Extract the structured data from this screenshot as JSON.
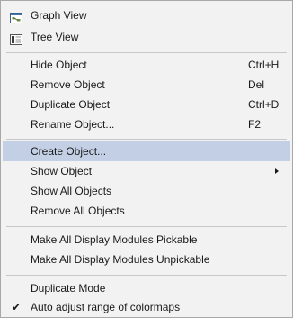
{
  "menu": {
    "items": [
      {
        "label": "Graph View",
        "icon": "graph-view-icon"
      },
      {
        "label": "Tree View",
        "icon": "tree-view-icon"
      },
      {
        "label": "Hide Object",
        "shortcut": "Ctrl+H"
      },
      {
        "label": "Remove Object",
        "shortcut": "Del"
      },
      {
        "label": "Duplicate Object",
        "shortcut": "Ctrl+D"
      },
      {
        "label": "Rename Object...",
        "shortcut": "F2"
      },
      {
        "label": "Create Object...",
        "highlighted": true
      },
      {
        "label": "Show Object",
        "submenu": true
      },
      {
        "label": "Show All Objects"
      },
      {
        "label": "Remove All Objects"
      },
      {
        "label": "Make All Display Modules Pickable"
      },
      {
        "label": "Make All Display Modules Unpickable"
      },
      {
        "label": "Duplicate Mode"
      },
      {
        "label": "Auto adjust range of colormaps",
        "checked": true
      }
    ],
    "highlight_color": "#c2cfe4",
    "check_glyph": "✔"
  }
}
